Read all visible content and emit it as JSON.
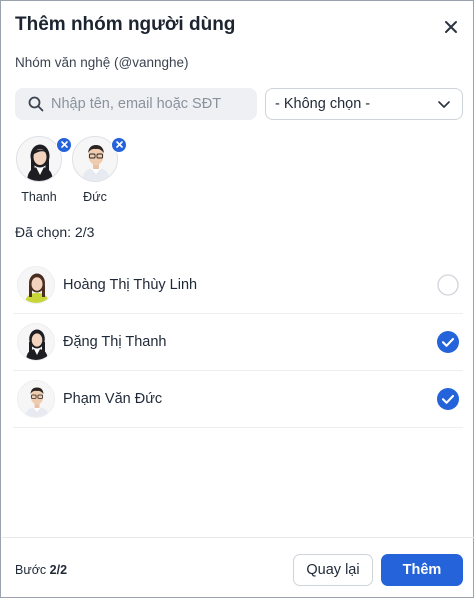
{
  "dialog": {
    "title": "Thêm nhóm người dùng",
    "subtitle": "Nhóm văn nghệ (@vannghe)"
  },
  "search": {
    "placeholder": "Nhập tên, email hoặc SĐT",
    "value": ""
  },
  "filter": {
    "selected": "- Không chọn -"
  },
  "selected_chips": [
    {
      "name": "Thanh",
      "avatar": "female-avatar"
    },
    {
      "name": "Đức",
      "avatar": "male-avatar"
    }
  ],
  "selection_count": "Đã chọn: 2/3",
  "users": [
    {
      "name": "Hoàng Thị Thùy Linh",
      "checked": false,
      "avatar": "female-avatar"
    },
    {
      "name": "Đặng Thị Thanh",
      "checked": true,
      "avatar": "female-avatar"
    },
    {
      "name": "Phạm Văn Đức",
      "checked": true,
      "avatar": "male-avatar"
    }
  ],
  "footer": {
    "step_label": "Bước",
    "step_value": "2/2",
    "back_label": "Quay lại",
    "submit_label": "Thêm"
  },
  "colors": {
    "primary": "#2463d9",
    "border": "#cfd4da",
    "search_bg": "#eef0f3"
  }
}
